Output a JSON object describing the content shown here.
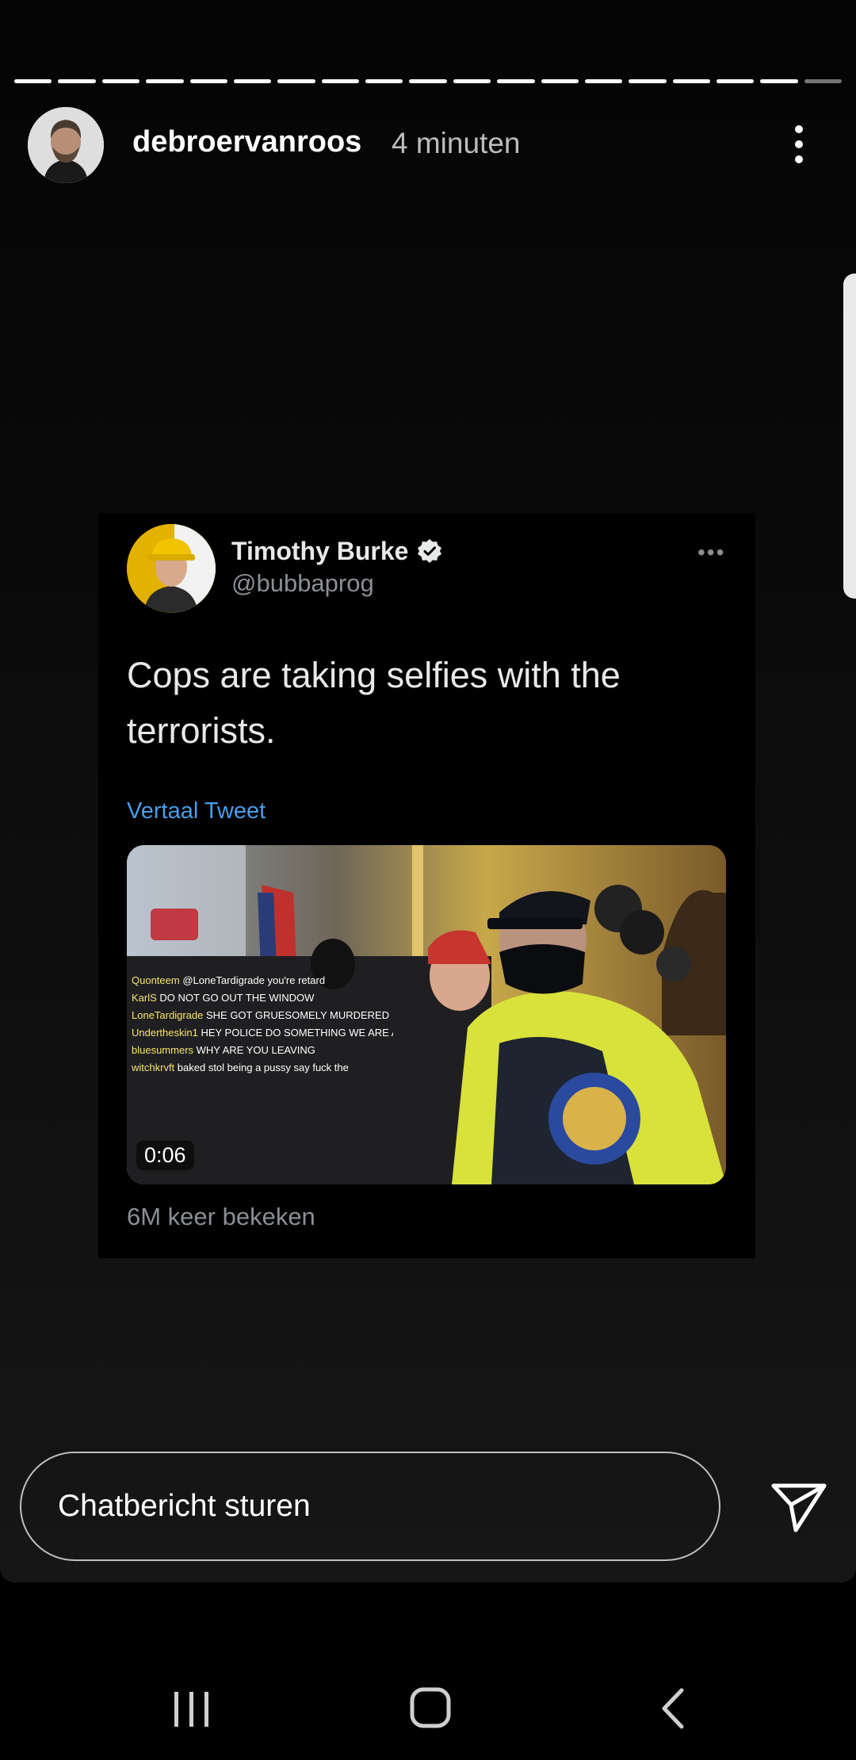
{
  "story": {
    "username": "debroervanroos",
    "time": "4 minuten",
    "progress_segments": 19,
    "progress_viewed": 18
  },
  "tweet": {
    "name": "Timothy Burke",
    "handle": "@bubbaprog",
    "text": "Cops are taking selfies with the terrorists.",
    "translate": "Vertaal Tweet",
    "video_duration": "0:06",
    "views": "6M keer bekeken",
    "video_chat": [
      {
        "user": "Quonteem",
        "msg": "@LoneTardigrade you're retard"
      },
      {
        "user": "KarlS",
        "msg": "DO NOT GO OUT THE WINDOW"
      },
      {
        "user": "LoneTardigrade",
        "msg": "SHE GOT GRUESOMELY MURDERED"
      },
      {
        "user": "Undertheskin1",
        "msg": "HEY POLICE DO SOMETHING WE ARE ALL WATCHING"
      },
      {
        "user": "bluesummers",
        "msg": "WHY ARE YOU LEAVING"
      },
      {
        "user": "witchkrvft",
        "msg": "baked stol being a pussy say fuck the"
      }
    ]
  },
  "reply": {
    "placeholder": "Chatbericht sturen"
  },
  "icons": {
    "more": "vertical-dots-icon",
    "send": "paper-plane-icon",
    "verified": "verified-badge-icon",
    "nav_recents": "recents-icon",
    "nav_home": "home-icon",
    "nav_back": "back-icon"
  },
  "colors": {
    "link": "#4a9de8",
    "background": "#0b0b0b"
  }
}
